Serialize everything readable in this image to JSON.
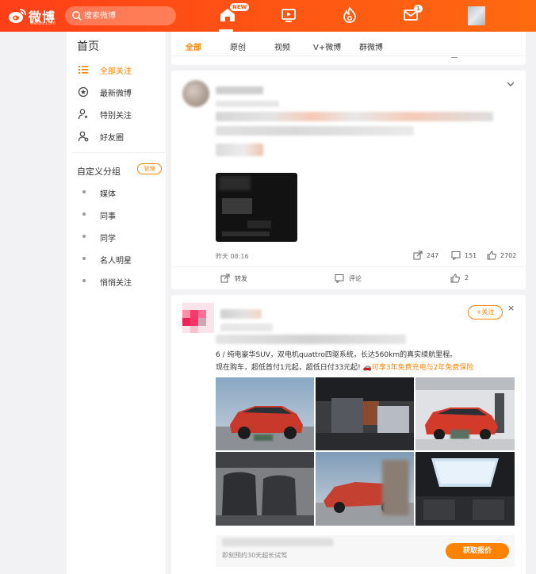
{
  "header": {
    "logo_text": "微博",
    "logo_sub": "weibo.com",
    "search_placeholder": "搜索微博",
    "home_badge": "NEW",
    "message_badge": "1"
  },
  "sidebar": {
    "title": "首页",
    "items": [
      {
        "label": "全部关注",
        "icon": "list-icon"
      },
      {
        "label": "最新微博",
        "icon": "star-circle-icon"
      },
      {
        "label": "特别关注",
        "icon": "user-star-icon"
      },
      {
        "label": "好友圈",
        "icon": "user-group-icon"
      }
    ],
    "group_title": "自定义分组",
    "manage_label": "管理",
    "groups": [
      "媒体",
      "同事",
      "同学",
      "名人明星",
      "悄悄关注"
    ]
  },
  "tabs": [
    "全部",
    "原创",
    "视频",
    "V+微博",
    "群微博"
  ],
  "post1": {
    "time": "昨天 08:16",
    "stats": {
      "share": "247",
      "comment": "151",
      "like": "2702"
    },
    "actions": {
      "repost": "转发",
      "comment": "评论",
      "like": "2"
    }
  },
  "post2": {
    "follow_label": "+关注",
    "close_label": "×",
    "text_line1": "6 / 纯电豪华SUV，双电机quattro四驱系统，长达560km的真实续航里程。",
    "text_line2": "现在购车，超低首付1元起，超低日付33元起!",
    "text_highlight": "🚗可享3年免费充电与2年免费保险",
    "ad_text": "即刻预约30天超长试驾",
    "ad_button": "获取报价"
  },
  "colors": {
    "brand": "#ff5a10",
    "accent": "#ff8200",
    "background": "#f2f2f5"
  }
}
